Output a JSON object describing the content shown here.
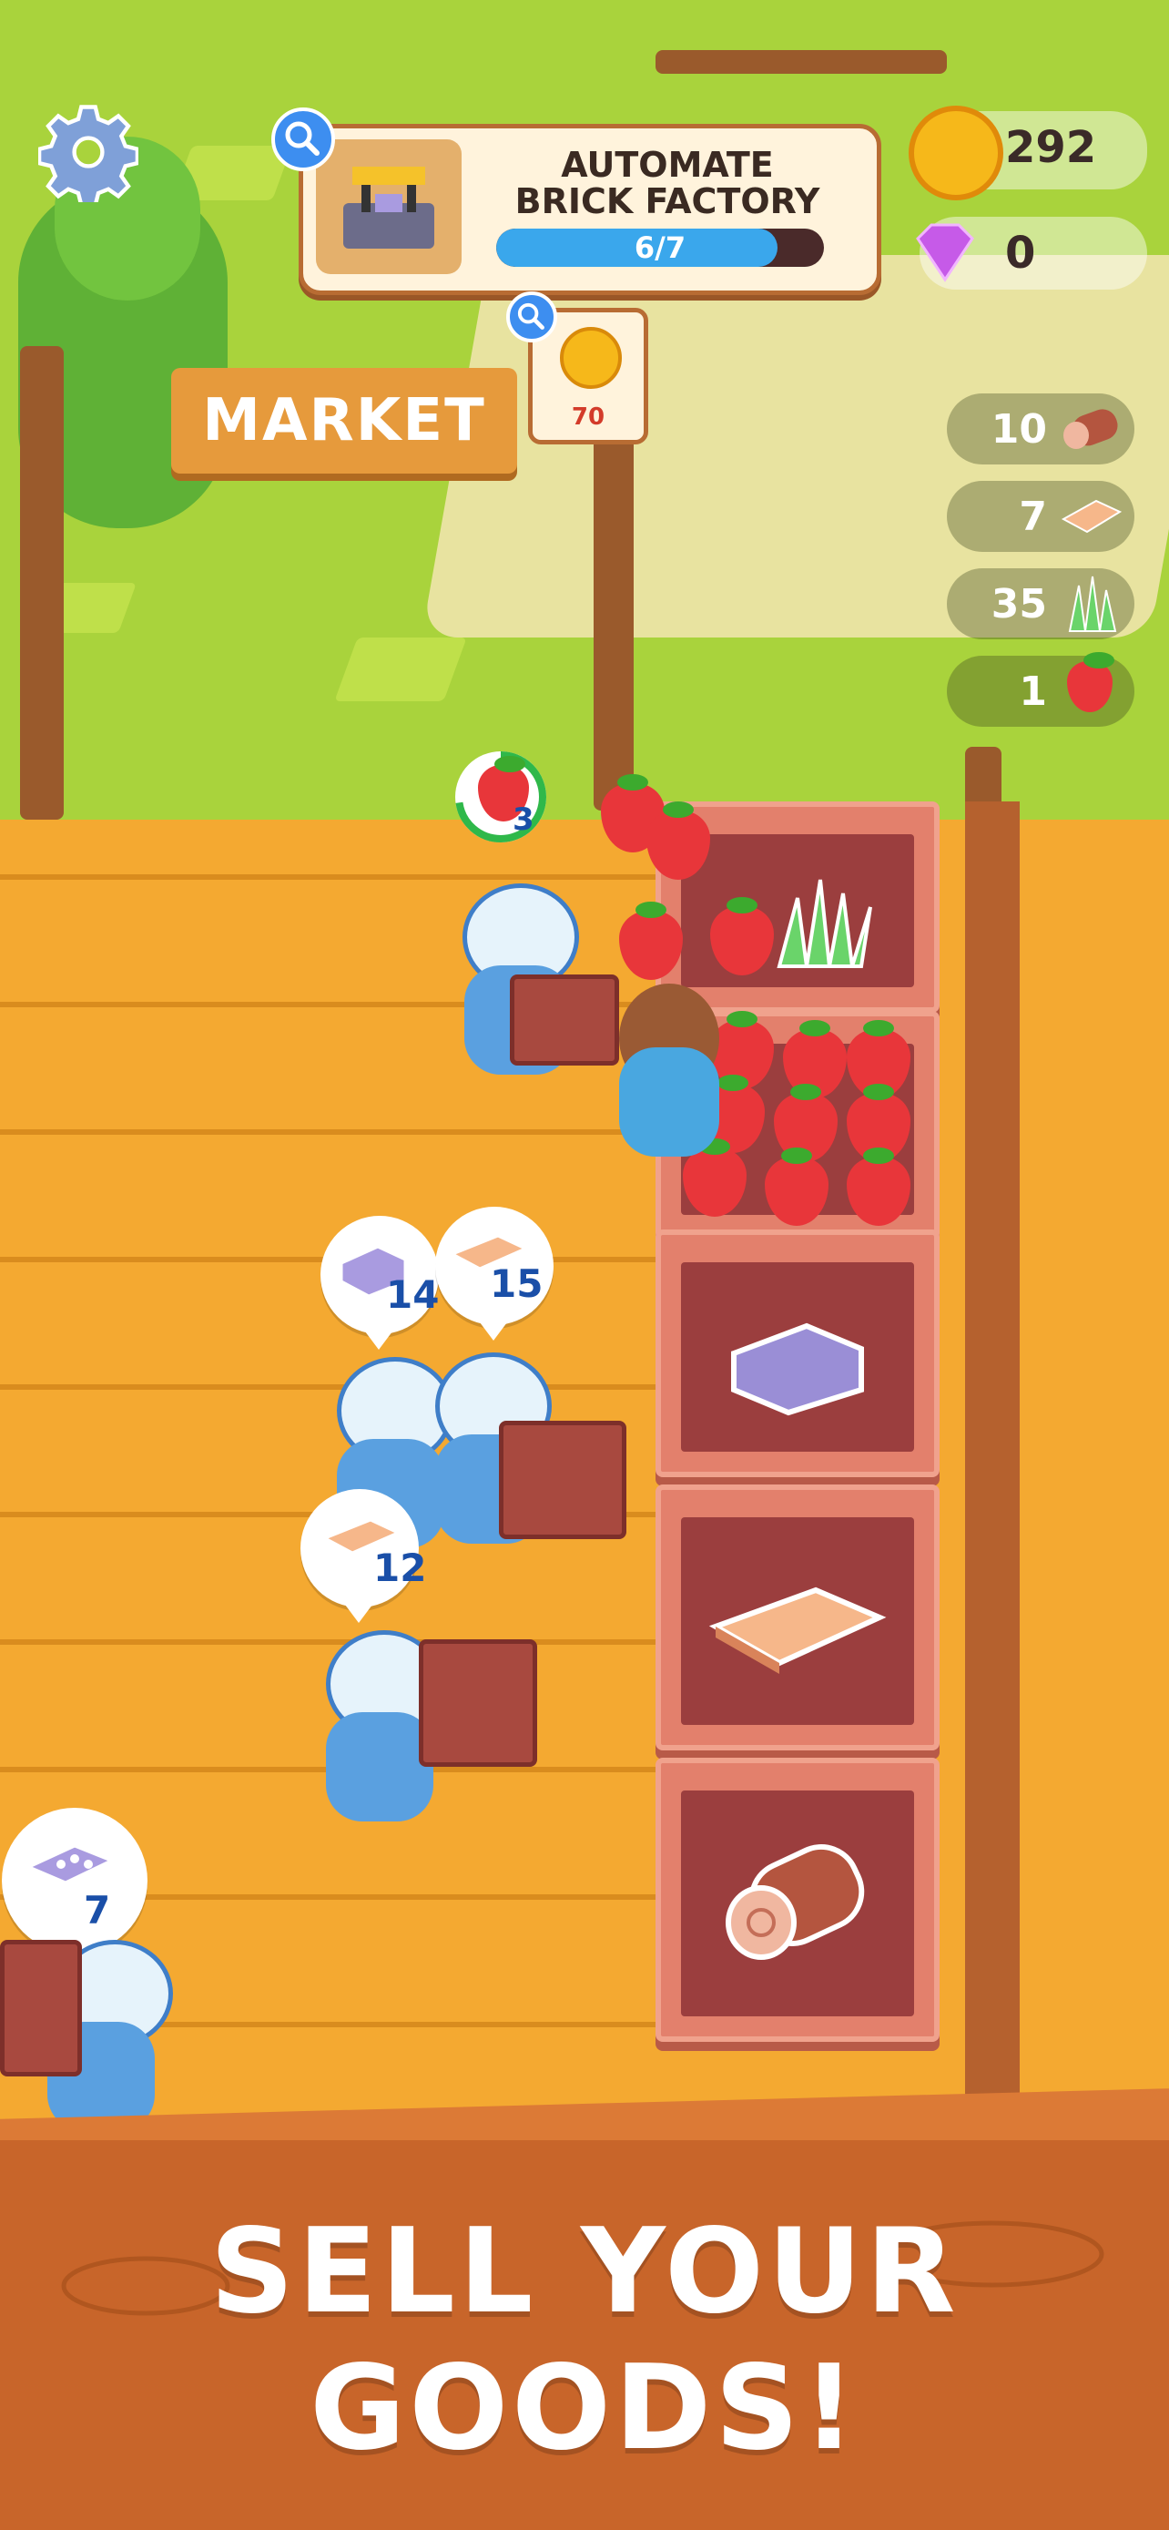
{
  "hud": {
    "task": {
      "title_line1": "AUTOMATE",
      "title_line2": "BRICK FACTORY",
      "progress_text": "6/7",
      "progress_fraction": 0.857
    },
    "coins": "292",
    "gems": "0",
    "resources": [
      {
        "name": "wood-log-icon",
        "count": "10"
      },
      {
        "name": "plank-icon",
        "count": "7"
      },
      {
        "name": "grass-icon",
        "count": "35"
      },
      {
        "name": "strawberry-icon",
        "count": "1"
      }
    ]
  },
  "market": {
    "sign": "MARKET",
    "price": "70"
  },
  "player": {
    "carry_count": "3"
  },
  "customers": [
    {
      "item": "stone-block-icon",
      "count": "14"
    },
    {
      "item": "plank-icon",
      "count": "15"
    },
    {
      "item": "plank-icon",
      "count": "12"
    },
    {
      "item": "brick-icon",
      "count": "7"
    }
  ],
  "banner": {
    "line1": "SELL YOUR",
    "line2": "GOODS!"
  },
  "colors": {
    "grass": "#a9d33c",
    "deck": "#f4a931",
    "water": "#2bb8e8",
    "banner": "#c8652a",
    "accent_blue": "#3aa7ec"
  }
}
